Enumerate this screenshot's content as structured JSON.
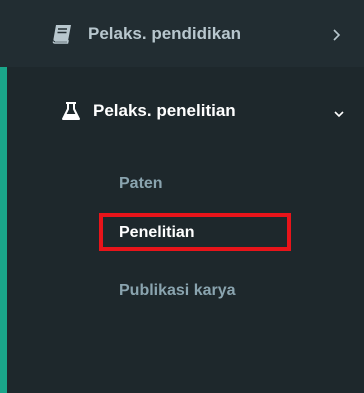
{
  "sidebar": {
    "accent_color": "#1aa68a",
    "background_color": "#222d32",
    "highlight_color": "#e8141a",
    "items": [
      {
        "label": "Pelaks. pendidikan",
        "icon": "book-icon",
        "expand_indicator": "chevron-right-icon",
        "expanded": false
      },
      {
        "label": "Pelaks. penelitian",
        "icon": "flask-icon",
        "expand_indicator": "chevron-down-icon",
        "expanded": true,
        "subitems": [
          {
            "label": "Paten"
          },
          {
            "label": "Penelitian",
            "highlighted": true
          },
          {
            "label": "Publikasi karya"
          }
        ]
      }
    ]
  }
}
